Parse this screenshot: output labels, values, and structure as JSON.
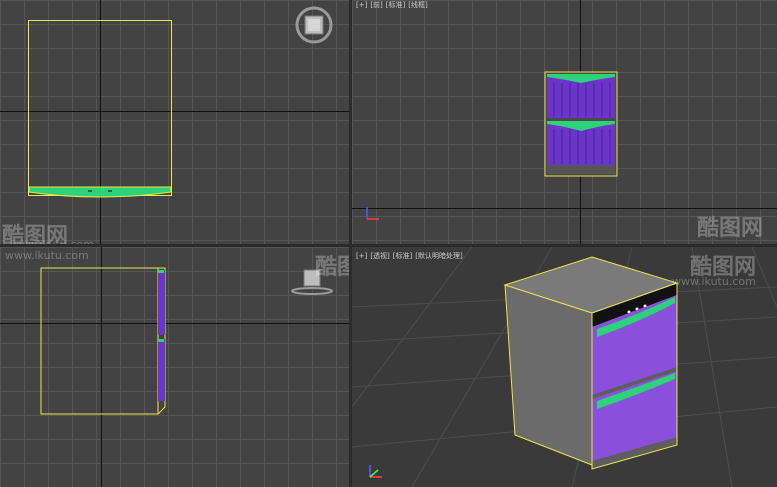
{
  "viewports": {
    "front": {
      "labels": [
        "[+]",
        "[前]",
        "[标准]",
        "[线框]"
      ]
    },
    "perspective": {
      "labels": [
        "[+]",
        "[透视]",
        "[标准]",
        "[默认明暗处理]"
      ]
    }
  },
  "watermark": {
    "brand": "酷图网",
    "url": "www.ikutu.com"
  },
  "colors": {
    "viewport_bg": "#434343",
    "grid_line": "#555555",
    "selection": "#e8e84a",
    "drawer_purple": "#6a35c8",
    "handle_green": "#2ed27a",
    "cabinet_gray": "#6e6e6e"
  }
}
